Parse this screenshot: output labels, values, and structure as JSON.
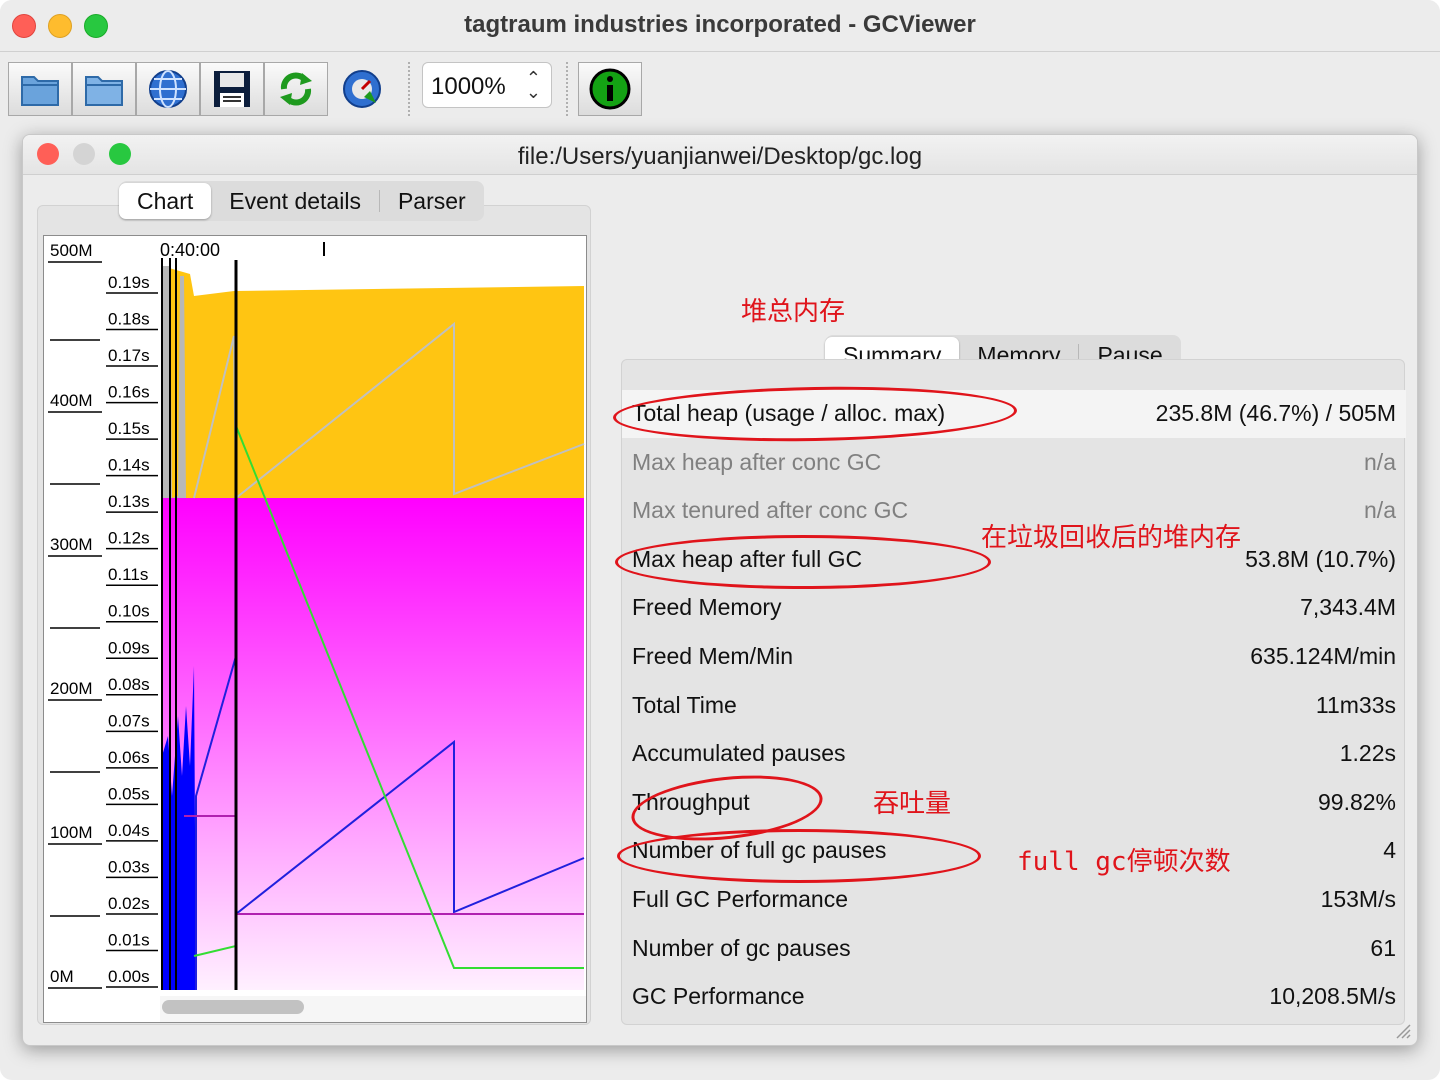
{
  "window": {
    "title": "tagtraum industries incorporated - GCViewer"
  },
  "toolbar": {
    "buttons": [
      {
        "icon": "open-file-icon"
      },
      {
        "icon": "open-folder-icon"
      },
      {
        "icon": "open-url-icon"
      },
      {
        "icon": "save-icon"
      },
      {
        "icon": "refresh-icon"
      },
      {
        "icon": "watch-icon"
      }
    ],
    "zoom_value": "1000%",
    "info_icon": "info-icon"
  },
  "document": {
    "title": "file:/Users/yuanjianwei/Desktop/gc.log"
  },
  "left_tabs": [
    "Chart",
    "Event details",
    "Parser"
  ],
  "right_tabs": [
    "Summary",
    "Memory",
    "Pause"
  ],
  "chart": {
    "time_label": "0:40:00",
    "memory_axis": [
      "500M",
      "400M",
      "300M",
      "200M",
      "100M",
      "0M"
    ],
    "pause_axis": [
      "0.19s",
      "0.18s",
      "0.17s",
      "0.16s",
      "0.15s",
      "0.14s",
      "0.13s",
      "0.12s",
      "0.11s",
      "0.10s",
      "0.09s",
      "0.08s",
      "0.07s",
      "0.06s",
      "0.05s",
      "0.04s",
      "0.03s",
      "0.02s",
      "0.01s",
      "0.00s"
    ],
    "colors": {
      "total_heap": "#ffc512",
      "tenured": "#ff00ff",
      "young": "#0000ff",
      "full_gc_line": "#000000",
      "gc_pauses": "#a0a0a0",
      "freed_line": "#33dd33"
    }
  },
  "summary": [
    {
      "label": "Total heap (usage / alloc. max)",
      "value": "235.8M (46.7%) / 505M",
      "dim": false
    },
    {
      "label": "Max heap after conc GC",
      "value": "n/a",
      "dim": true
    },
    {
      "label": "Max tenured after conc GC",
      "value": "n/a",
      "dim": true
    },
    {
      "label": "Max heap after full GC",
      "value": "53.8M (10.7%)",
      "dim": false
    },
    {
      "label": "Freed Memory",
      "value": "7,343.4M",
      "dim": false
    },
    {
      "label": "Freed Mem/Min",
      "value": "635.124M/min",
      "dim": false
    },
    {
      "label": "Total Time",
      "value": "11m33s",
      "dim": false
    },
    {
      "label": "Accumulated pauses",
      "value": "1.22s",
      "dim": false
    },
    {
      "label": "Throughput",
      "value": "99.82%",
      "dim": false
    },
    {
      "label": "Number of full gc pauses",
      "value": "4",
      "dim": false
    },
    {
      "label": "Full GC Performance",
      "value": "153M/s",
      "dim": false
    },
    {
      "label": "Number of gc pauses",
      "value": "61",
      "dim": false
    },
    {
      "label": "GC Performance",
      "value": "10,208.5M/s",
      "dim": false
    }
  ],
  "annotations": {
    "heap_total": "堆总内存",
    "heap_after_gc": "在垃圾回收后的堆内存",
    "throughput": "吞吐量",
    "full_gc_count": "full  gc停顿次数",
    "color": "#e0141b"
  }
}
